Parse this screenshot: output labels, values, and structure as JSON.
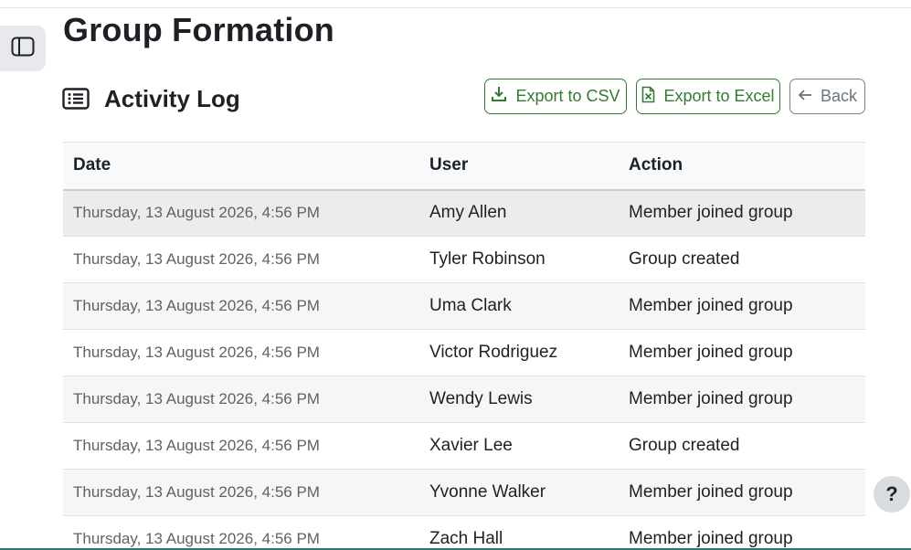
{
  "page": {
    "title": "Group Formation"
  },
  "section": {
    "title": "Activity Log"
  },
  "actions": {
    "export_csv": "Export to CSV",
    "export_excel": "Export to Excel",
    "back": "Back"
  },
  "table": {
    "headers": {
      "date": "Date",
      "user": "User",
      "action": "Action"
    },
    "rows": [
      {
        "date": "Thursday, 13 August 2026, 4:56 PM",
        "user": "Amy Allen",
        "action": "Member joined group"
      },
      {
        "date": "Thursday, 13 August 2026, 4:56 PM",
        "user": "Tyler Robinson",
        "action": "Group created"
      },
      {
        "date": "Thursday, 13 August 2026, 4:56 PM",
        "user": "Uma Clark",
        "action": "Member joined group"
      },
      {
        "date": "Thursday, 13 August 2026, 4:56 PM",
        "user": "Victor Rodriguez",
        "action": "Member joined group"
      },
      {
        "date": "Thursday, 13 August 2026, 4:56 PM",
        "user": "Wendy Lewis",
        "action": "Member joined group"
      },
      {
        "date": "Thursday, 13 August 2026, 4:56 PM",
        "user": "Xavier Lee",
        "action": "Group created"
      },
      {
        "date": "Thursday, 13 August 2026, 4:56 PM",
        "user": "Yvonne Walker",
        "action": "Member joined group"
      },
      {
        "date": "Thursday, 13 August 2026, 4:56 PM",
        "user": "Zach Hall",
        "action": "Member joined group"
      }
    ]
  },
  "help": {
    "label": "?"
  },
  "icons": {
    "drawer": "sidebar-panel-icon",
    "section": "list-icon",
    "csv": "download-icon",
    "excel": "excel-file-icon",
    "back": "arrow-left-icon"
  },
  "colors": {
    "export_accent": "#357a32",
    "back_border": "#7b8187",
    "hover_row": "#ececec",
    "striped_row": "#f6f6f6",
    "bottom_accent": "#2a7a73"
  }
}
